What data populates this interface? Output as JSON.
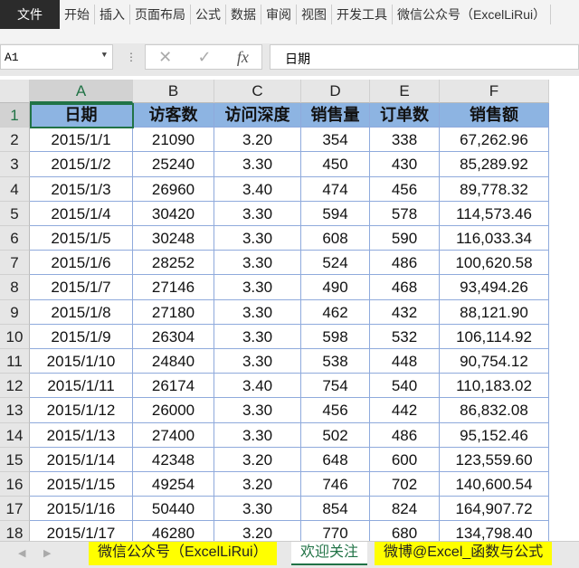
{
  "ribbon": {
    "file": "文件",
    "tabs": [
      "开始",
      "插入",
      "页面布局",
      "公式",
      "数据",
      "审阅",
      "视图",
      "开发工具",
      "微信公众号（ExcelLiRui）"
    ]
  },
  "formula_bar": {
    "name_box": "A1",
    "cancel_icon": "✕",
    "enter_icon": "✓",
    "fx": "fx",
    "value": "日期"
  },
  "columns": [
    "A",
    "B",
    "C",
    "D",
    "E",
    "F"
  ],
  "selected_cell": "A1",
  "header_row": [
    "日期",
    "访客数",
    "访问深度",
    "销售量",
    "订单数",
    "销售额"
  ],
  "rows": [
    [
      "2015/1/1",
      "21090",
      "3.20",
      "354",
      "338",
      "67,262.96"
    ],
    [
      "2015/1/2",
      "25240",
      "3.30",
      "450",
      "430",
      "85,289.92"
    ],
    [
      "2015/1/3",
      "26960",
      "3.40",
      "474",
      "456",
      "89,778.32"
    ],
    [
      "2015/1/4",
      "30420",
      "3.30",
      "594",
      "578",
      "114,573.46"
    ],
    [
      "2015/1/5",
      "30248",
      "3.30",
      "608",
      "590",
      "116,033.34"
    ],
    [
      "2015/1/6",
      "28252",
      "3.30",
      "524",
      "486",
      "100,620.58"
    ],
    [
      "2015/1/7",
      "27146",
      "3.30",
      "490",
      "468",
      "93,494.26"
    ],
    [
      "2015/1/8",
      "27180",
      "3.30",
      "462",
      "432",
      "88,121.90"
    ],
    [
      "2015/1/9",
      "26304",
      "3.30",
      "598",
      "532",
      "106,114.92"
    ],
    [
      "2015/1/10",
      "24840",
      "3.30",
      "538",
      "448",
      "90,754.12"
    ],
    [
      "2015/1/11",
      "26174",
      "3.40",
      "754",
      "540",
      "110,183.02"
    ],
    [
      "2015/1/12",
      "26000",
      "3.30",
      "456",
      "442",
      "86,832.08"
    ],
    [
      "2015/1/13",
      "27400",
      "3.30",
      "502",
      "486",
      "95,152.46"
    ],
    [
      "2015/1/14",
      "42348",
      "3.20",
      "648",
      "600",
      "123,559.60"
    ],
    [
      "2015/1/15",
      "49254",
      "3.20",
      "746",
      "702",
      "140,600.54"
    ],
    [
      "2015/1/16",
      "50440",
      "3.30",
      "854",
      "824",
      "164,907.72"
    ],
    [
      "2015/1/17",
      "46280",
      "3.20",
      "770",
      "680",
      "134,798.40"
    ]
  ],
  "sheet_tabs": [
    {
      "label": "微信公众号（ExcelLiRui）",
      "color": "#ffff00"
    },
    {
      "label": "欢迎关注",
      "active": true
    },
    {
      "label": "微博@Excel_函数与公式",
      "color": "#ffff00"
    }
  ]
}
